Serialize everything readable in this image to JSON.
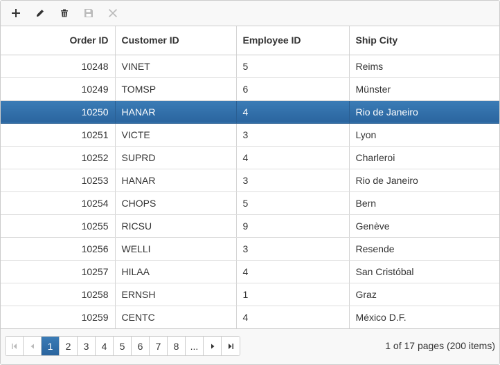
{
  "toolbar": {
    "buttons": [
      {
        "name": "add-icon",
        "enabled": true
      },
      {
        "name": "edit-icon",
        "enabled": true
      },
      {
        "name": "delete-icon",
        "enabled": true
      },
      {
        "name": "save-icon",
        "enabled": false
      },
      {
        "name": "cancel-icon",
        "enabled": false
      }
    ]
  },
  "grid": {
    "columns": [
      "Order ID",
      "Customer ID",
      "Employee ID",
      "Ship City"
    ],
    "selected_row": 2,
    "rows": [
      [
        "10248",
        "VINET",
        "5",
        "Reims"
      ],
      [
        "10249",
        "TOMSP",
        "6",
        "Münster"
      ],
      [
        "10250",
        "HANAR",
        "4",
        "Rio de Janeiro"
      ],
      [
        "10251",
        "VICTE",
        "3",
        "Lyon"
      ],
      [
        "10252",
        "SUPRD",
        "4",
        "Charleroi"
      ],
      [
        "10253",
        "HANAR",
        "3",
        "Rio de Janeiro"
      ],
      [
        "10254",
        "CHOPS",
        "5",
        "Bern"
      ],
      [
        "10255",
        "RICSU",
        "9",
        "Genève"
      ],
      [
        "10256",
        "WELLI",
        "3",
        "Resende"
      ],
      [
        "10257",
        "HILAA",
        "4",
        "San Cristóbal"
      ],
      [
        "10258",
        "ERNSH",
        "1",
        "Graz"
      ],
      [
        "10259",
        "CENTC",
        "4",
        "México D.F."
      ]
    ]
  },
  "pager": {
    "pages": [
      "1",
      "2",
      "3",
      "4",
      "5",
      "6",
      "7",
      "8",
      "..."
    ],
    "current_page": "1",
    "info": "1 of 17 pages (200 items)"
  },
  "colors": {
    "selected_row": "#2a649e",
    "border": "#cccccc",
    "toolbar_bg": "#f8f8f8"
  }
}
